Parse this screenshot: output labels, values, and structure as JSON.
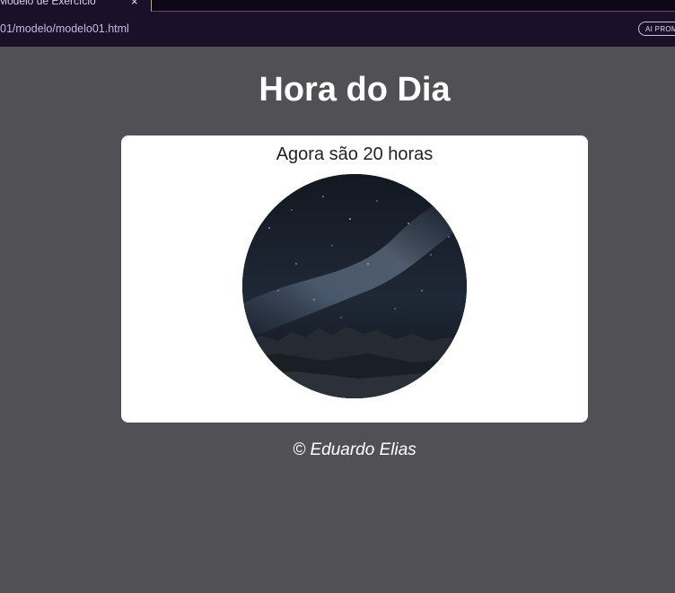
{
  "browser": {
    "tab_title": "Modelo de Exercício",
    "tab_close": "×",
    "url": "01/modelo/modelo01.html",
    "ai_badge": "AI PROM"
  },
  "page": {
    "title": "Hora do Dia",
    "message": "Agora são 20 horas",
    "image_icon": "night-sky-mountains-photo",
    "footer": "© Eduardo Elias"
  },
  "colors": {
    "background": "#515055",
    "card": "#ffffff",
    "title_text": "#ffffff"
  }
}
